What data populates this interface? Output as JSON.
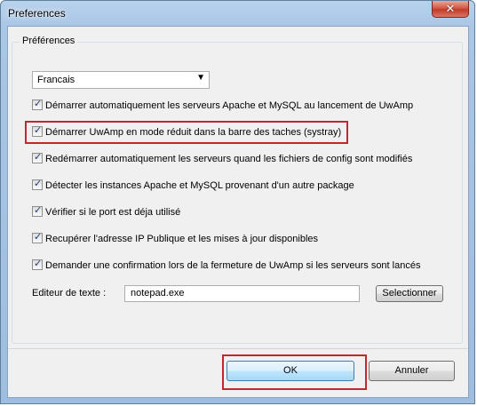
{
  "window": {
    "title": "Preferences"
  },
  "group": {
    "label": "Préférences"
  },
  "language": {
    "selected": "Francais"
  },
  "options": [
    {
      "label": "Démarrer automatiquement les serveurs Apache et MySQL au lancement de UwAmp",
      "checked": true
    },
    {
      "label": "Démarrer UwAmp en mode réduit dans la barre des taches (systray)",
      "checked": true
    },
    {
      "label": "Redémarrer automatiquement les serveurs quand les fichiers de config sont modifiés",
      "checked": true
    },
    {
      "label": "Détecter les instances Apache et MySQL provenant d'un autre package",
      "checked": true
    },
    {
      "label": "Vérifier si le port est déja utilisé",
      "checked": true
    },
    {
      "label": "Recupérer l'adresse IP Publique et les mises à jour disponibles",
      "checked": true
    },
    {
      "label": "Demander une confirmation lors de la fermeture de UwAmp si les serveurs sont lancés",
      "checked": true
    }
  ],
  "editor": {
    "label": "Editeur de texte :",
    "value": "notepad.exe",
    "select_button": "Selectionner"
  },
  "buttons": {
    "ok": "OK",
    "cancel": "Annuler"
  },
  "colors": {
    "highlight": "#c0282d",
    "title_bar": "#a9c6e6"
  }
}
